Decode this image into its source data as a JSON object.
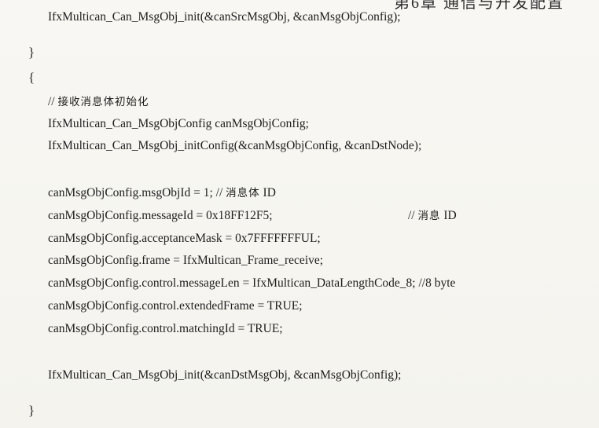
{
  "header": {
    "text": "第6章  通信与开发配置"
  },
  "code": {
    "line1": "IfxMultican_Can_MsgObj_init(&canSrcMsgObj, &canMsgObjConfig);",
    "brace_close1": "}",
    "brace_open": "{",
    "comment_prefix": "// ",
    "comment_text": "接收消息体初始化",
    "line_decl": "IfxMultican_Can_MsgObjConfig canMsgObjConfig;",
    "line_initconfig": "IfxMultican_Can_MsgObj_initConfig(&canMsgObjConfig, &canDstNode);",
    "line_msgobjid_code": "canMsgObjConfig.msgObjId = 1; // ",
    "line_msgobjid_cjk": "消息体",
    "line_msgobjid_tail": " ID",
    "line_messageid_code": "canMsgObjConfig.messageId = 0x18FF12F5;",
    "line_messageid_comment_prefix": "// ",
    "line_messageid_cjk": "消息",
    "line_messageid_tail": " ID",
    "line_mask": "canMsgObjConfig.acceptanceMask = 0x7FFFFFFFUL;",
    "line_frame": "canMsgObjConfig.frame = IfxMultican_Frame_receive;",
    "line_len": "canMsgObjConfig.control.messageLen = IfxMultican_DataLengthCode_8; //8 byte",
    "line_ext": "canMsgObjConfig.control.extendedFrame = TRUE;",
    "line_match": "canMsgObjConfig.control.matchingId = TRUE;",
    "line_init_dst": "IfxMultican_Can_MsgObj_init(&canDstMsgObj, &canMsgObjConfig);",
    "brace_close2": "}"
  }
}
